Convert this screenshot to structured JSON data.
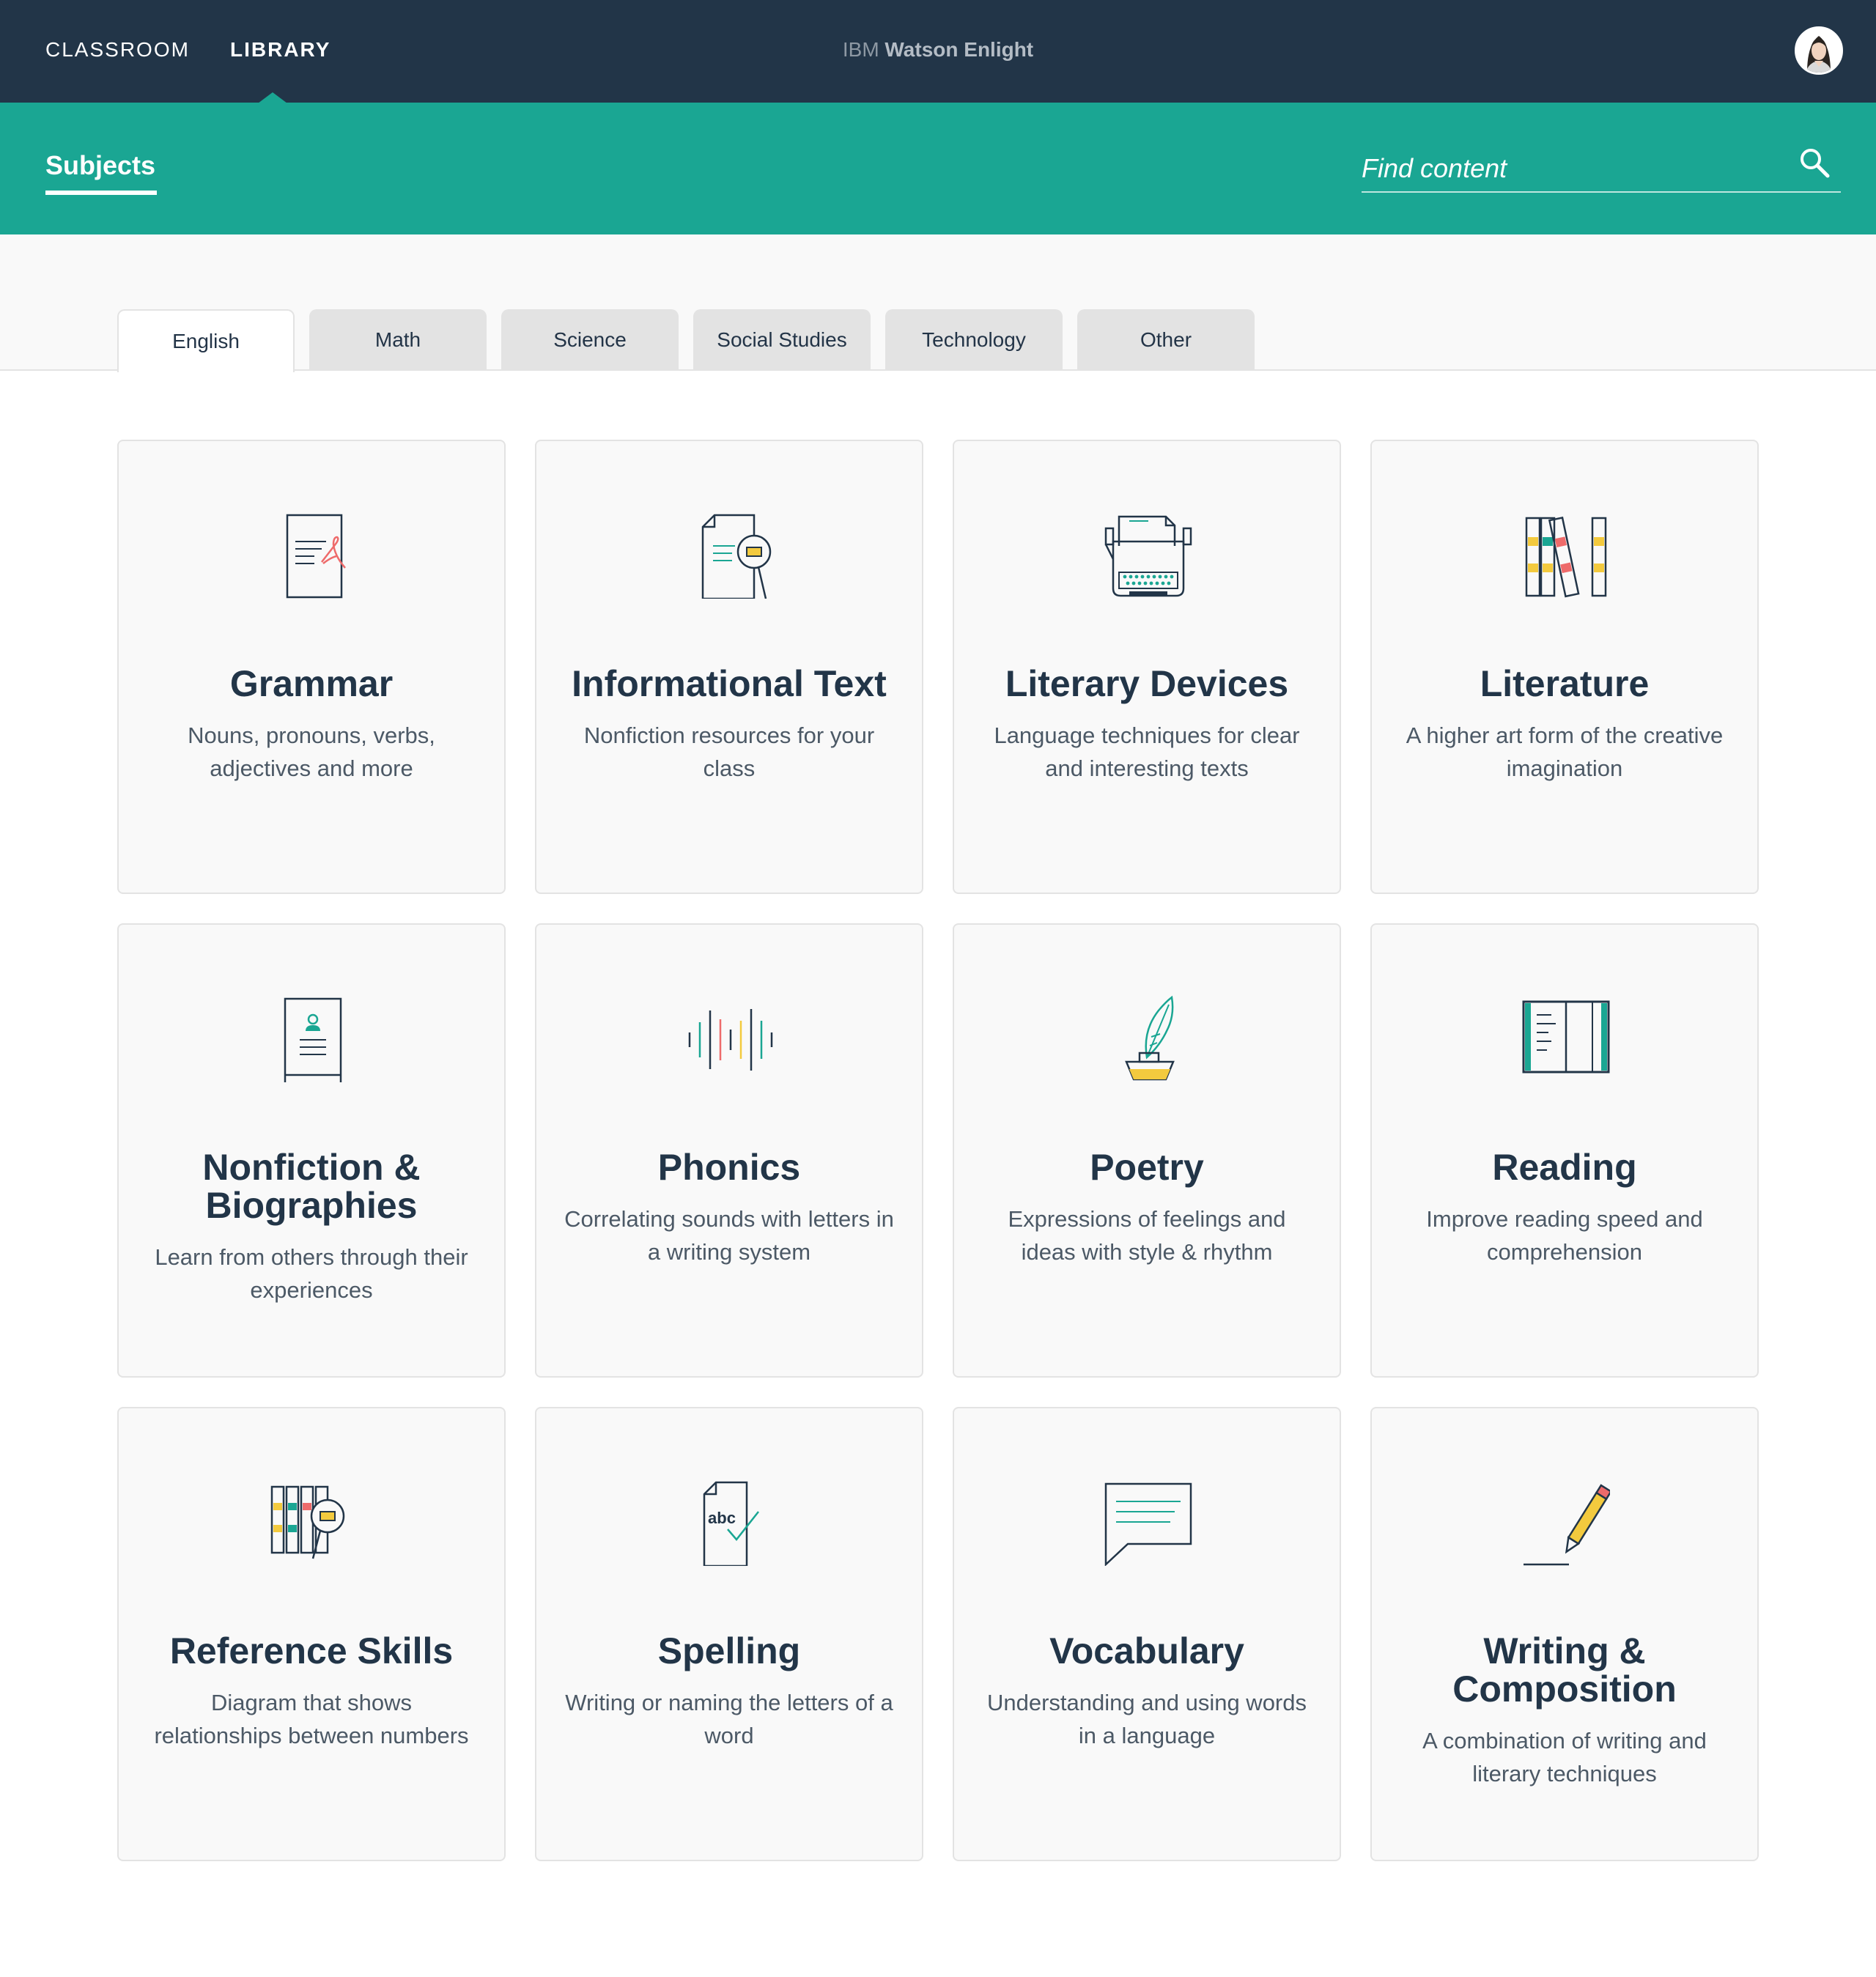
{
  "nav": {
    "classroom": "CLASSROOM",
    "library": "LIBRARY",
    "active": "library"
  },
  "brand": {
    "prefix": "IBM",
    "name": "Watson Enlight"
  },
  "header": {
    "title": "Subjects",
    "search_placeholder": "Find content",
    "search_value": "",
    "search_icon": "search-icon"
  },
  "tabs": [
    {
      "label": "English",
      "active": true
    },
    {
      "label": "Math",
      "active": false
    },
    {
      "label": "Science",
      "active": false
    },
    {
      "label": "Social Studies",
      "active": false
    },
    {
      "label": "Technology",
      "active": false
    },
    {
      "label": "Other",
      "active": false
    }
  ],
  "cards": [
    {
      "title": "Grammar",
      "description": "Nouns, pronouns, verbs, adjectives and more",
      "icon": "document-ribbon-icon"
    },
    {
      "title": "Informational Text",
      "description": "Nonfiction resources for your class",
      "icon": "document-magnifier-icon"
    },
    {
      "title": "Literary Devices",
      "description": "Language techniques for clear and interesting texts",
      "icon": "typewriter-icon"
    },
    {
      "title": "Literature",
      "description": "A higher art form of the creative imagination",
      "icon": "book-spines-icon"
    },
    {
      "title": "Nonfiction & Biographies",
      "description": "Learn from others through their experiences",
      "icon": "profile-book-icon"
    },
    {
      "title": "Phonics",
      "description": "Correlating sounds with letters in a writing system",
      "icon": "sound-wave-icon"
    },
    {
      "title": "Poetry",
      "description": "Expressions of feelings and ideas with style & rhythm",
      "icon": "quill-inkwell-icon"
    },
    {
      "title": "Reading",
      "description": "Improve reading speed and comprehension",
      "icon": "open-book-icon"
    },
    {
      "title": "Reference Skills",
      "description": "Diagram that shows relationships between numbers",
      "icon": "books-magnifier-icon"
    },
    {
      "title": "Spelling",
      "description": "Writing or naming the letters of a word",
      "icon": "abc-checkmark-icon",
      "icon_text": "abc"
    },
    {
      "title": "Vocabulary",
      "description": "Understanding and using words in a language",
      "icon": "speech-bubble-icon"
    },
    {
      "title": "Writing & Composition",
      "description": "A combination of writing and literary techniques",
      "icon": "pencil-icon"
    }
  ],
  "colors": {
    "navy": "#223548",
    "teal": "#1aa693",
    "yellow": "#f3ca3e",
    "coral": "#ee6b6b",
    "card_bg": "#f9f9f9",
    "border": "#e3e3e3"
  }
}
